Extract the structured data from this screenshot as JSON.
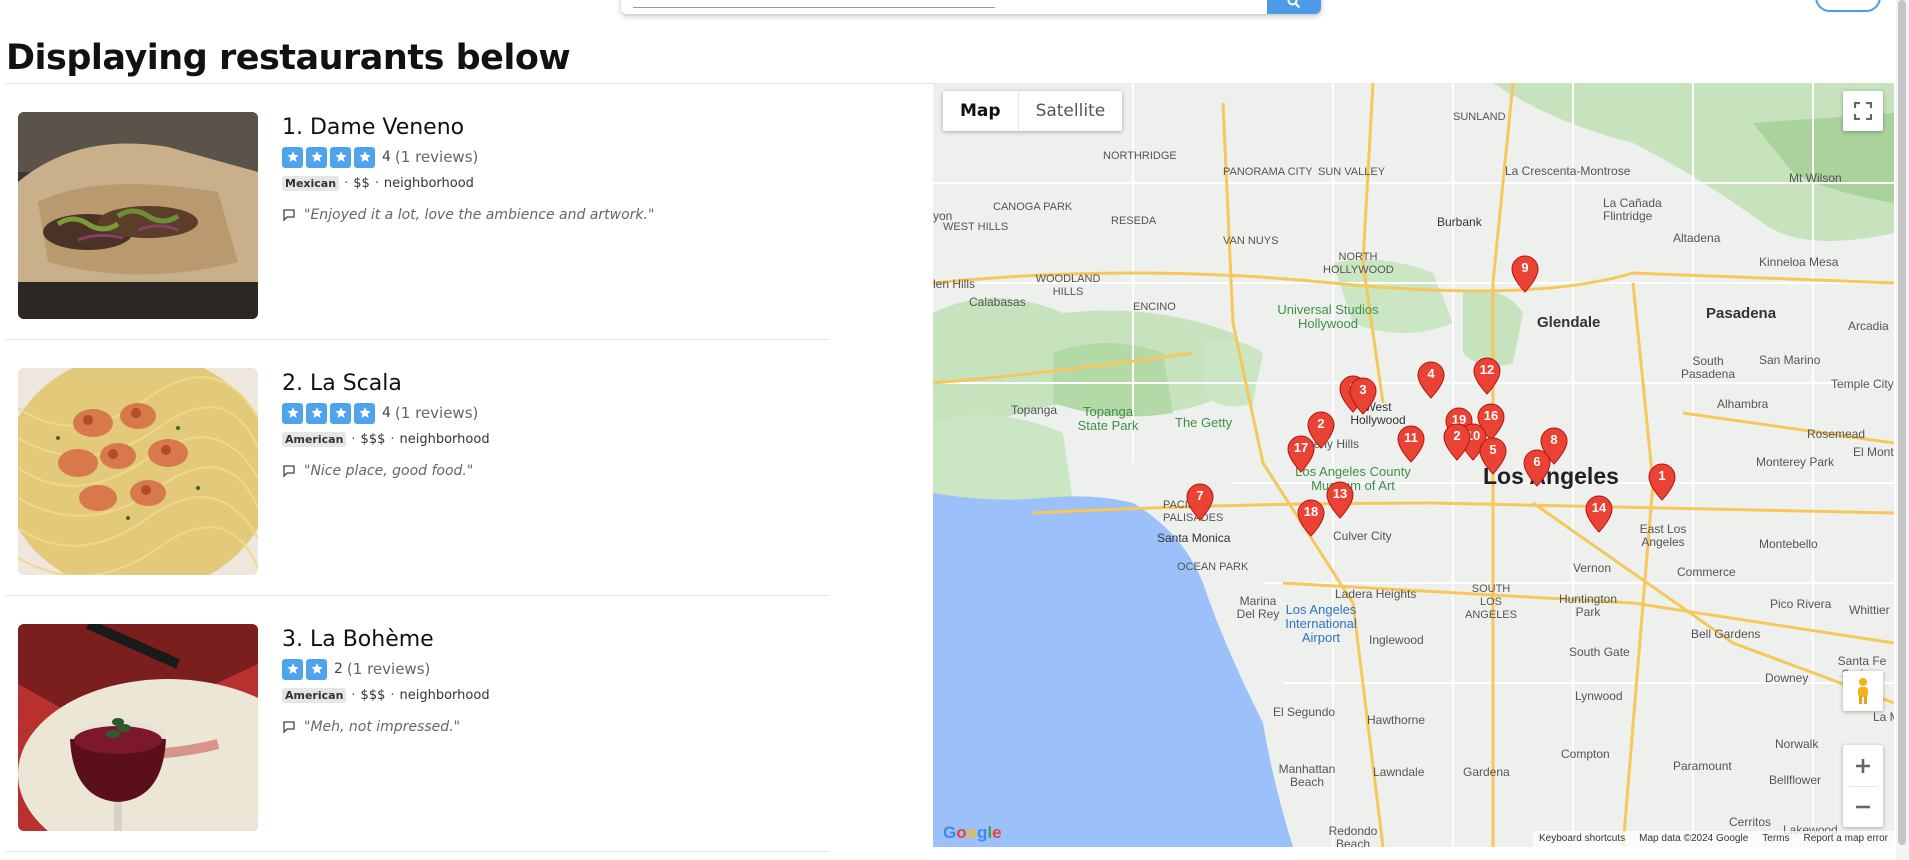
{
  "page": {
    "title": "Displaying restaurants below"
  },
  "colors": {
    "accent": "#4fa3ec",
    "pin": "#ea4335",
    "water": "#9cc0f9",
    "park": "#c9e7c3"
  },
  "restaurants": [
    {
      "name": "1. Dame Veneno",
      "stars": 4,
      "rating": "4",
      "reviews": "(1 reviews)",
      "cuisine": "Mexican",
      "price": "$$",
      "type": "neighborhood",
      "quote": "\"Enjoyed it a lot, love the ambience and artwork.\""
    },
    {
      "name": "2. La Scala",
      "stars": 4,
      "rating": "4",
      "reviews": "(1 reviews)",
      "cuisine": "American",
      "price": "$$$",
      "type": "neighborhood",
      "quote": "\"Nice place, good food.\""
    },
    {
      "name": "3. La Bohème",
      "stars": 2,
      "rating": "2",
      "reviews": "(1 reviews)",
      "cuisine": "American",
      "price": "$$$",
      "type": "neighborhood",
      "quote": "\"Meh, not impressed.\""
    }
  ],
  "map": {
    "tab_map": "Map",
    "tab_satellite": "Satellite",
    "logo": "Google",
    "footer": {
      "shortcuts": "Keyboard shortcuts",
      "data": "Map data ©2024 Google",
      "terms": "Terms",
      "report": "Report a map error"
    },
    "places": {
      "sunland": "SUNLAND",
      "northridge": "NORTHRIDGE",
      "panorama": "PANORAMA CITY",
      "sunvalley": "SUN VALLEY",
      "crescenta": "La Crescenta-Montrose",
      "canada": "La Cañada Flintridge",
      "wilson": "Mt Wilson",
      "canoga": "CANOGA PARK",
      "reseda": "RESEDA",
      "vannuys": "VAN NUYS",
      "westhills": "WEST HILLS",
      "northhollywood": "NORTH HOLLYWOOD",
      "burbank": "Burbank",
      "altadena": "Altadena",
      "kinneloa": "Kinneloa Mesa",
      "calabasas": "Calabasas",
      "woodland": "WOODLAND HILLS",
      "encino": "ENCINO",
      "universal": "Universal Studios Hollywood",
      "glendale": "Glendale",
      "pasadena": "Pasadena",
      "arcadia": "Arcadia",
      "southpasadena": "South Pasadena",
      "sanmarino": "San Marino",
      "templecity": "Temple City",
      "topanga": "Topanga",
      "topangapark": "Topanga State Park",
      "getty": "The Getty",
      "westhollywood": "West Hollywood",
      "beverly": "Beverly Hills",
      "alhambra": "Alhambra",
      "rosemead": "Rosemead",
      "lacma": "Los Angeles County Museum of Art",
      "losangeles": "Los Angeles",
      "montereypark": "Monterey Park",
      "elmonte": "El Monte",
      "pacific": "PACIFIC PALISADES",
      "santamonica": "Santa Monica",
      "culver": "Culver City",
      "eastla": "East Los Angeles",
      "montebello": "Montebello",
      "oceanpark": "OCEAN PARK",
      "vernon": "Vernon",
      "commerce": "Commerce",
      "marina": "Marina Del Rey",
      "ladera": "Ladera Heights",
      "southla": "SOUTH LOS ANGELES",
      "huntington": "Huntington Park",
      "picorivera": "Pico Rivera",
      "whittier": "Whittier",
      "lax": "Los Angeles International Airport",
      "inglewood": "Inglewood",
      "southgate": "South Gate",
      "bellgardens": "Bell Gardens",
      "downey": "Downey",
      "santafe": "Santa Fe Springs",
      "elsegundo": "El Segundo",
      "hawthorne": "Hawthorne",
      "lynwood": "Lynwood",
      "norwalk": "Norwalk",
      "compton": "Compton",
      "paramount": "Paramount",
      "bellflower": "Bellflower",
      "manhattan": "Manhattan Beach",
      "lawndale": "Lawndale",
      "gardena": "Gardena",
      "redondo": "Redondo Beach",
      "lakewood": "Lakewood",
      "cerritos": "Cerritos",
      "lam": "La M",
      "yon": "yon",
      "enhills": "len Hills"
    },
    "pins": [
      "9",
      "12",
      "4",
      "1",
      "3",
      "16",
      "19",
      "2",
      "10",
      "2",
      "11",
      "5",
      "17",
      "8",
      "6",
      "1",
      "7",
      "13",
      "14",
      "18"
    ]
  }
}
